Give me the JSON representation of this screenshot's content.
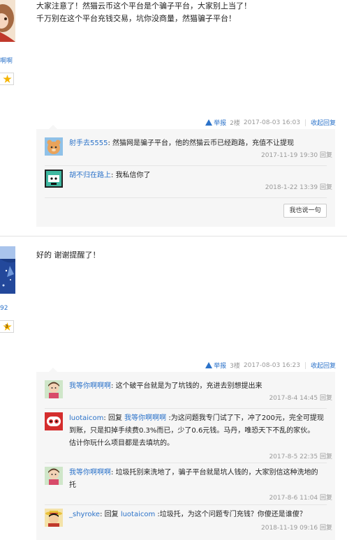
{
  "post1": {
    "username_fragment": "啊啊",
    "level": "",
    "text_line1": "大家注意了！然猫云币这个平台是个骗子平台，大家别上当了！",
    "text_line2": "千万别在这个平台充钱交易，坑你没商量，然猫骗子平台！",
    "meta": {
      "report": "举报",
      "floor": "2楼",
      "time": "2017-08-03 16:03",
      "collapse": "收起回复"
    },
    "replies": [
      {
        "user": "射手去5555",
        "text": "然猫网是骗子平台，他的然猫云币已经跑路，充值不让提现",
        "time": "2017-11-19 19:30",
        "reply": "回复"
      },
      {
        "user": "胡不归在路上",
        "text": "我私信你了",
        "time": "2018-1-22 13:39",
        "reply": "回复"
      }
    ],
    "say_button": "我也说一句"
  },
  "post2": {
    "username_fragment": "92",
    "level": "3",
    "text": "好的 谢谢提醒了！",
    "meta": {
      "report": "举报",
      "floor": "3楼",
      "time": "2017-08-03 16:23",
      "collapse": "收起回复"
    },
    "replies": [
      {
        "user": "我等你啊啊啊",
        "text": "这个破平台就是为了坑钱的，充进去别想提出来",
        "time": "2017-8-4 14:45",
        "reply": "回复"
      },
      {
        "user": "luotaicom",
        "prefix": "回复",
        "reply_to": "我等你啊啊啊",
        "text_line1": ":为这问题我专门试了下，冲了200元，完全可提现",
        "text_line2": "到账，只是扣掉手续费0.3%而已，少了0.6元钱。马丹，唯恐天下不乱的家伙。",
        "text_line3": "估计你玩什么项目都是去填坑的。",
        "time": "2017-8-5 22:35",
        "reply": "回复"
      },
      {
        "user": "我等你啊啊啊",
        "text_line1": "垃圾托别来洗地了，骗子平台就是坑人钱的，大家别信这种洗地的",
        "text_line2": "托",
        "time": "2017-8-6 11:04",
        "reply": "回复"
      },
      {
        "user": "_shyroke",
        "prefix": "回复",
        "reply_to": "luotaicom",
        "text": ":垃圾托，为这个问题专门充钱？你傻还是谁傻？",
        "time": "2018-11-19 09:16",
        "reply": "回复"
      }
    ]
  },
  "colors": {
    "link": "#2b72c9",
    "muted": "#999999",
    "reply_bg": "#f6f6f6",
    "star": "#f5b400"
  },
  "icons": [
    "warning-icon",
    "star-level-icon",
    "avatar"
  ]
}
